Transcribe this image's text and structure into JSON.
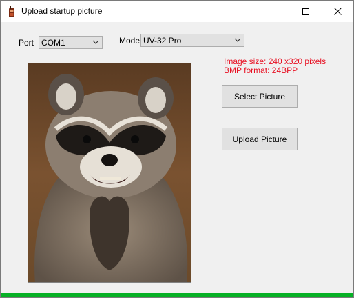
{
  "window": {
    "title": "Upload startup picture",
    "icon": "radio-device-icon",
    "controls": [
      "minimize-icon",
      "maximize-icon",
      "close-icon"
    ]
  },
  "port": {
    "label": "Port",
    "value": "COM1"
  },
  "model": {
    "label": "Model",
    "value": "UV-32 Pro"
  },
  "info": {
    "image_size": "Image size: 240 x320 pixels",
    "bmp_format": "BMP format: 24BPP",
    "color": "#e81123"
  },
  "buttons": {
    "select": "Select Picture",
    "upload": "Upload Picture"
  },
  "preview": {
    "subject": "raccoon-photo"
  },
  "progress": {
    "fraction": 1.0,
    "color": "#06b025"
  }
}
